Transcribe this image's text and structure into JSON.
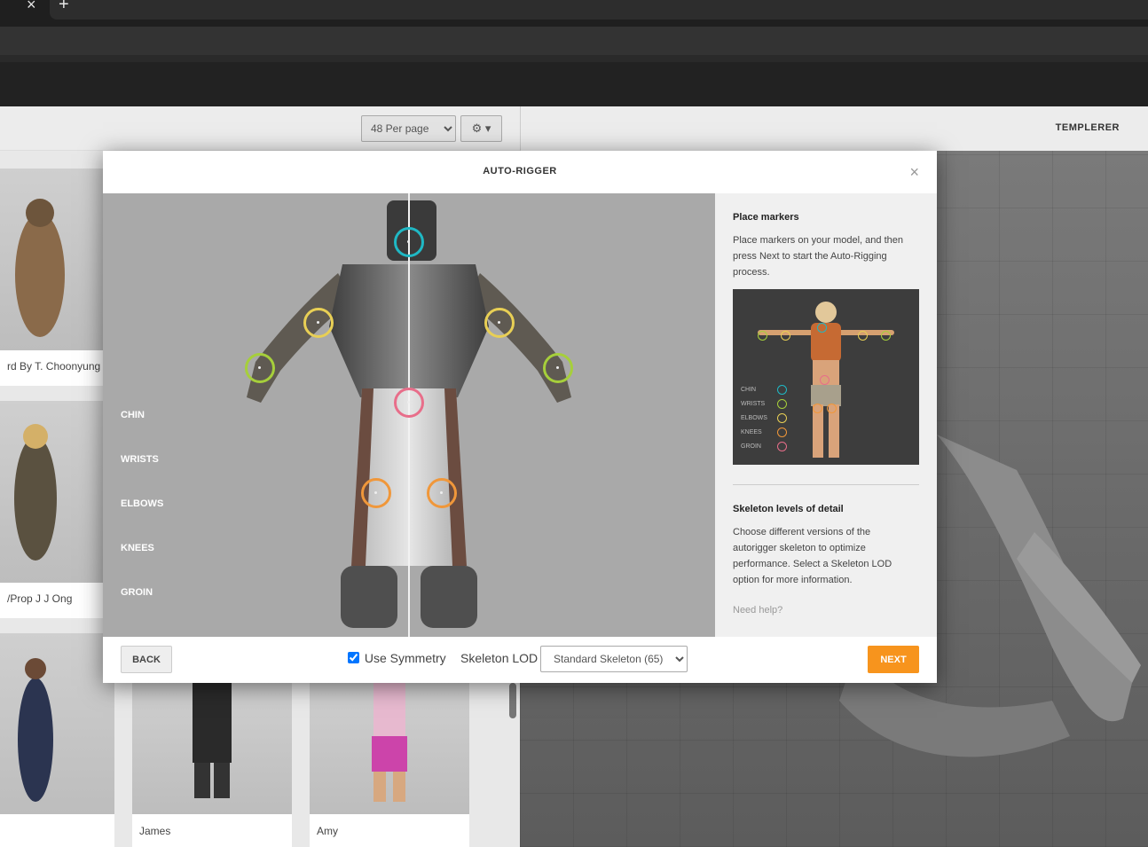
{
  "browser": {
    "tab_close_icon": "×",
    "new_tab_icon": "+"
  },
  "library": {
    "per_page": "48 Per page",
    "cards": [
      {
        "name": "rd By T. Choonyung"
      },
      {
        "name": "/Prop J J Ong"
      },
      {
        "name": ""
      },
      {
        "name": "James"
      },
      {
        "name": "Amy"
      }
    ]
  },
  "right_panel": {
    "title": "TEMPLERER"
  },
  "modal": {
    "title": "AUTO-RIGGER",
    "close_icon": "×",
    "marker_labels": {
      "chin": "CHIN",
      "wrists": "WRISTS",
      "elbows": "ELBOWS",
      "knees": "KNEES",
      "groin": "GROIN"
    },
    "marker_colors": {
      "chin": "#1fb8c4",
      "wrists": "#a6cf3b",
      "elbows": "#e8cf55",
      "knees": "#f0973a",
      "groin": "#e86e8a"
    },
    "side": {
      "place_heading": "Place markers",
      "place_text": "Place markers on your model, and then press Next to start the Auto-Rigging process.",
      "preview_labels": {
        "chin": "CHIN",
        "wrists": "WRISTS",
        "elbows": "ELBOWS",
        "knees": "KNEES",
        "groin": "GROIN"
      },
      "lod_heading": "Skeleton levels of detail",
      "lod_text": "Choose different versions of the autorigger skeleton to optimize performance. Select a Skeleton LOD option for more information.",
      "help_link": "Need help?"
    },
    "footer": {
      "back_label": "BACK",
      "symmetry_label": "Use Symmetry",
      "symmetry_checked": true,
      "lod_label": "Skeleton LOD",
      "lod_value": "Standard Skeleton (65)",
      "next_label": "NEXT"
    }
  }
}
